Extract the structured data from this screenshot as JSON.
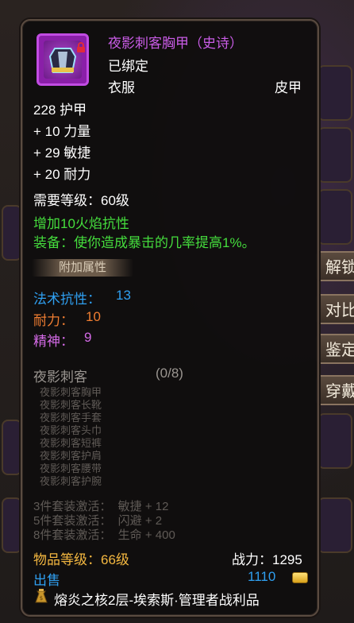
{
  "item": {
    "name": "夜影刺客胸甲（史诗）",
    "bound": "已绑定",
    "slot": "衣服",
    "armor_type": "皮甲",
    "armor": "228 护甲",
    "stats": [
      "+ 10 力量",
      "+ 29 敏捷",
      "+ 20 耐力"
    ],
    "required_level": "需要等级：60级",
    "effect_1": "增加10火焰抗性",
    "effect_2": "装备：使你造成暴击的几率提高1%。",
    "extra_attr_title": "附加属性",
    "extra_attrs": [
      {
        "label": "法术抗性：",
        "value": "13"
      },
      {
        "label": "耐力：",
        "value": "10"
      },
      {
        "label": "精神：",
        "value": "9"
      }
    ],
    "set_name": "夜影刺客",
    "set_count": "(0/8)",
    "set_items": [
      "夜影刺客胸甲",
      "夜影刺客长靴",
      "夜影刺客手套",
      "夜影刺客头巾",
      "夜影刺客短裤",
      "夜影刺客护肩",
      "夜影刺客腰带",
      "夜影刺客护腕"
    ],
    "set_bonuses": [
      "3件套装激活：  敏捷 + 12",
      "5件套装激活：  闪避 + 2",
      "8件套装激活：  生命 + 400"
    ],
    "item_level": "物品等级：66级",
    "power": "战力：1295",
    "sell_label": "出售",
    "sell_price": "1110",
    "source": "熔炎之核2层-埃索斯·管理者战利品",
    "icon": "chest-armor-icon",
    "lock": "lock-icon"
  },
  "side_buttons": [
    "解锁",
    "对比",
    "鉴定",
    "穿戴"
  ],
  "colors": {
    "epic_purple": "#c95ce6",
    "effect_green": "#45dd3d",
    "stat_blue": "#2f9ff0",
    "stat_orange": "#ef7d31",
    "stat_violet": "#d46ae6",
    "item_level_gold": "#f3b740"
  }
}
